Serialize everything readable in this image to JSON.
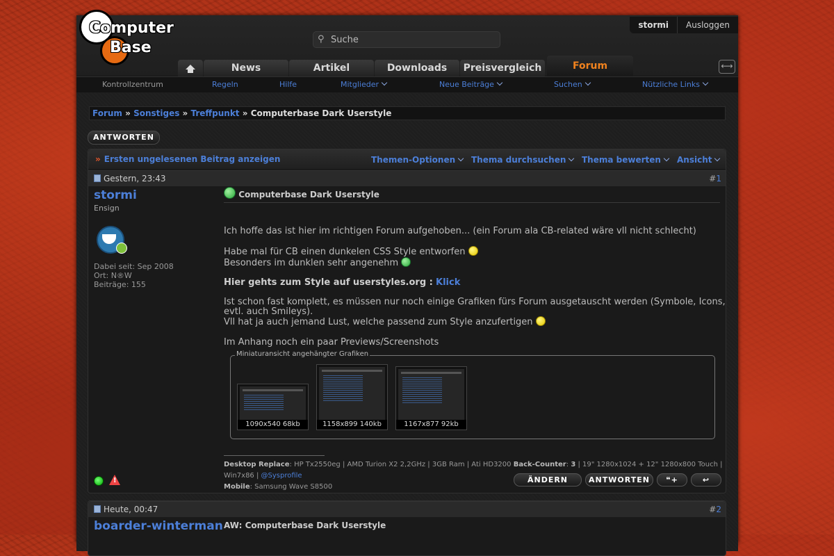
{
  "header": {
    "logo_line1": "Computer",
    "logo_line2": "Base",
    "search_placeholder": "Suche",
    "username": "stormi",
    "logout": "Ausloggen",
    "tabs": [
      "News",
      "Artikel",
      "Downloads",
      "Preisvergleich",
      "Forum"
    ],
    "active_tab": "Forum"
  },
  "subnav": [
    "Kontrollzentrum",
    "Regeln",
    "Hilfe",
    "Mitglieder",
    "Neue Beiträge",
    "Suchen",
    "Nützliche Links"
  ],
  "breadcrumb": {
    "items": [
      "Forum",
      "Sonstiges",
      "Treffpunkt"
    ],
    "sep": "»",
    "current": "Computerbase Dark Userstyle"
  },
  "reply_button": "ANTWORTEN",
  "thread_bar": {
    "first_unread": "Ersten ungelesenen Beitrag anzeigen",
    "options": [
      "Themen-Optionen",
      "Thema durchsuchen",
      "Thema bewerten",
      "Ansicht"
    ]
  },
  "post1": {
    "date": "Gestern, 23:43",
    "hash": "#",
    "number": "1",
    "author": "stormi",
    "rank": "Ensign",
    "joined": "Dabei seit: Sep 2008",
    "location": "Ort: N®W",
    "posts": "Beiträge: 155",
    "title": "Computerbase Dark Userstyle",
    "p1": "Ich hoffe das ist hier im richtigen Forum aufgehoben... (ein Forum ala CB-related wäre vll nicht schlecht)",
    "p2a": "Habe mal für CB einen dunkelen CSS Style entworfen",
    "p2b": "Besonders im dunklen sehr angenehm",
    "p3_bold": "Hier gehts zum Style auf userstyles.org :",
    "p3_link": "Klick",
    "p4a": "Ist schon fast komplett, es müssen nur noch einige Grafiken fürs Forum ausgetauscht werden (Symbole, Icons,",
    "p4b": "evtl. auch Smileys).",
    "p4c": "Vll hat ja auch jemand Lust, welche passend zum Style anzufertigen",
    "p5": "Im Anhang noch ein paar Previews/Screenshots",
    "attach_legend": "Miniaturansicht angehängter Grafiken",
    "thumbs": [
      "1090x540 68kb",
      "1158x899 140kb",
      "1167x877 92kb"
    ],
    "sig_label1": "Desktop Replace",
    "sig_text1": ": HP Tx2550eg | AMD Turion X2 2,2GHz | 3GB Ram | Ati HD3200 ",
    "sig_label2": "Back-Counter",
    "sig_text2": ": ",
    "sig_count": "3",
    "sig_text3": " | 19\" 1280x1024 + 12\" 1280x800 Touch | Win7x86 | ",
    "sig_link": "@Sysprofile",
    "sig_label3": "Mobile",
    "sig_text4": ": Samsung Wave S8500",
    "btn_edit": "ÄNDERN",
    "btn_reply": "ANTWORTEN",
    "btn_quote": "❝+",
    "btn_back": "↩"
  },
  "post2": {
    "date": "Heute, 00:47",
    "hash": "#",
    "number": "2",
    "author": "boarder-winterman",
    "title": "AW: Computerbase Dark Userstyle"
  },
  "colors": {
    "link": "#4c7fd8",
    "active_tab": "#f0821e",
    "background_red": "#9e2a14"
  }
}
